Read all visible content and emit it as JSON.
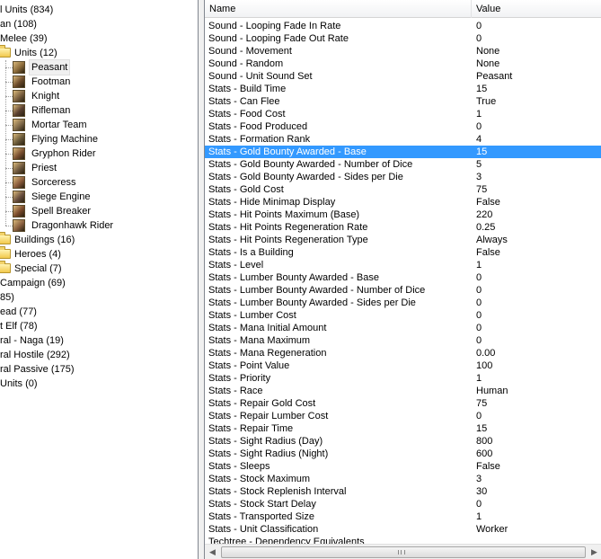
{
  "tree": {
    "items": [
      {
        "label": "l Units (834)",
        "level": 0,
        "icon": "none"
      },
      {
        "label": "an (108)",
        "level": 0,
        "icon": "none"
      },
      {
        "label": "Melee (39)",
        "level": 0,
        "icon": "none"
      },
      {
        "label": "Units (12)",
        "level": 1,
        "icon": "folder-open-icon"
      },
      {
        "label": "Peasant",
        "level": 2,
        "icon": "peasant-icon",
        "selected": true
      },
      {
        "label": "Footman",
        "level": 2,
        "icon": "footman-icon"
      },
      {
        "label": "Knight",
        "level": 2,
        "icon": "knight-icon"
      },
      {
        "label": "Rifleman",
        "level": 2,
        "icon": "rifleman-icon"
      },
      {
        "label": "Mortar Team",
        "level": 2,
        "icon": "mortar-team-icon"
      },
      {
        "label": "Flying Machine",
        "level": 2,
        "icon": "flying-machine-icon"
      },
      {
        "label": "Gryphon Rider",
        "level": 2,
        "icon": "gryphon-rider-icon"
      },
      {
        "label": "Priest",
        "level": 2,
        "icon": "priest-icon"
      },
      {
        "label": "Sorceress",
        "level": 2,
        "icon": "sorceress-icon"
      },
      {
        "label": "Siege Engine",
        "level": 2,
        "icon": "siege-engine-icon"
      },
      {
        "label": "Spell Breaker",
        "level": 2,
        "icon": "spell-breaker-icon"
      },
      {
        "label": "Dragonhawk Rider",
        "level": 2,
        "icon": "dragonhawk-rider-icon"
      },
      {
        "label": "Buildings (16)",
        "level": 1,
        "icon": "folder-icon"
      },
      {
        "label": "Heroes (4)",
        "level": 1,
        "icon": "folder-icon"
      },
      {
        "label": "Special (7)",
        "level": 1,
        "icon": "folder-icon"
      },
      {
        "label": "Campaign (69)",
        "level": 0,
        "icon": "none"
      },
      {
        "label": "85)",
        "level": 0,
        "icon": "none"
      },
      {
        "label": "ead (77)",
        "level": 0,
        "icon": "none"
      },
      {
        "label": "t Elf (78)",
        "level": 0,
        "icon": "none"
      },
      {
        "label": "ral - Naga (19)",
        "level": 0,
        "icon": "none"
      },
      {
        "label": "ral Hostile (292)",
        "level": 0,
        "icon": "none"
      },
      {
        "label": "ral Passive (175)",
        "level": 0,
        "icon": "none"
      },
      {
        "label": "Units (0)",
        "level": 0,
        "icon": "none"
      }
    ]
  },
  "list": {
    "columns": {
      "name": "Name",
      "value": "Value"
    },
    "selected_index": 10,
    "rows": [
      [
        "Sound - Looping Fade In Rate",
        "0"
      ],
      [
        "Sound - Looping Fade Out Rate",
        "0"
      ],
      [
        "Sound - Movement",
        "None"
      ],
      [
        "Sound - Random",
        "None"
      ],
      [
        "Sound - Unit Sound Set",
        "Peasant"
      ],
      [
        "Stats - Build Time",
        "15"
      ],
      [
        "Stats - Can Flee",
        "True"
      ],
      [
        "Stats - Food Cost",
        "1"
      ],
      [
        "Stats - Food Produced",
        "0"
      ],
      [
        "Stats - Formation Rank",
        "4"
      ],
      [
        "Stats - Gold Bounty Awarded - Base",
        "15"
      ],
      [
        "Stats - Gold Bounty Awarded - Number of Dice",
        "5"
      ],
      [
        "Stats - Gold Bounty Awarded - Sides per Die",
        "3"
      ],
      [
        "Stats - Gold Cost",
        "75"
      ],
      [
        "Stats - Hide Minimap Display",
        "False"
      ],
      [
        "Stats - Hit Points Maximum (Base)",
        "220"
      ],
      [
        "Stats - Hit Points Regeneration Rate",
        "0.25"
      ],
      [
        "Stats - Hit Points Regeneration Type",
        "Always"
      ],
      [
        "Stats - Is a Building",
        "False"
      ],
      [
        "Stats - Level",
        "1"
      ],
      [
        "Stats - Lumber Bounty Awarded - Base",
        "0"
      ],
      [
        "Stats - Lumber Bounty Awarded - Number of Dice",
        "0"
      ],
      [
        "Stats - Lumber Bounty Awarded - Sides per Die",
        "0"
      ],
      [
        "Stats - Lumber Cost",
        "0"
      ],
      [
        "Stats - Mana Initial Amount",
        "0"
      ],
      [
        "Stats - Mana Maximum",
        "0"
      ],
      [
        "Stats - Mana Regeneration",
        "0.00"
      ],
      [
        "Stats - Point Value",
        "100"
      ],
      [
        "Stats - Priority",
        "1"
      ],
      [
        "Stats - Race",
        "Human"
      ],
      [
        "Stats - Repair Gold Cost",
        "75"
      ],
      [
        "Stats - Repair Lumber Cost",
        "0"
      ],
      [
        "Stats - Repair Time",
        "15"
      ],
      [
        "Stats - Sight Radius (Day)",
        "800"
      ],
      [
        "Stats - Sight Radius (Night)",
        "600"
      ],
      [
        "Stats - Sleeps",
        "False"
      ],
      [
        "Stats - Stock Maximum",
        "3"
      ],
      [
        "Stats - Stock Replenish Interval",
        "30"
      ],
      [
        "Stats - Stock Start Delay",
        "0"
      ],
      [
        "Stats - Transported Size",
        "1"
      ],
      [
        "Stats - Unit Classification",
        "Worker"
      ],
      [
        "Techtree - Dependency Equivalents",
        ""
      ]
    ]
  },
  "colors": {
    "selection": "#3399ff",
    "pane_border": "#828790"
  }
}
